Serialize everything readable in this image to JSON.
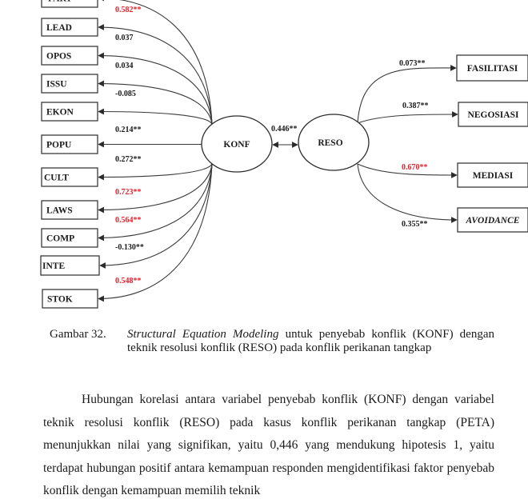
{
  "diagram": {
    "title": "Structural Equation Modeling KONF-RESO",
    "latent": {
      "konf": "KONF",
      "reso": "RESO",
      "correlation": "0.446**"
    },
    "indicators_konf": [
      {
        "label": "PART",
        "coef": "",
        "significant": false
      },
      {
        "label": "LEAD",
        "coef": "0.582**",
        "significant": true
      },
      {
        "label": "OPOS",
        "coef": "0.037",
        "significant": false
      },
      {
        "label": "ISSU",
        "coef": "0.034",
        "significant": false
      },
      {
        "label": "EKON",
        "coef": "-0.085",
        "significant": false
      },
      {
        "label": "POPU",
        "coef": "0.214**",
        "significant": false
      },
      {
        "label": "CULT",
        "coef": "0.272**",
        "significant": false
      },
      {
        "label": "LAWS",
        "coef": "0.723**",
        "significant": true
      },
      {
        "label": "COMP",
        "coef": "0.564**",
        "significant": true
      },
      {
        "label": "INTE",
        "coef": "-0.130**",
        "significant": false
      },
      {
        "label": "STOK",
        "coef": "0.548**",
        "significant": true
      }
    ],
    "indicators_reso": [
      {
        "label": "FASILITASI",
        "coef": "0.073**",
        "significant": false,
        "italic": false
      },
      {
        "label": "NEGOSIASI",
        "coef": "0.387**",
        "significant": false,
        "italic": false
      },
      {
        "label": "MEDIASI",
        "coef": "0.670**",
        "significant": true,
        "italic": false
      },
      {
        "label": "AVOIDANCE",
        "coef": "0.355**",
        "significant": false,
        "italic": true
      }
    ],
    "colors": {
      "significant": "#e8202a",
      "normal": "#1a1a1a"
    }
  },
  "caption": {
    "number": "Gambar 32.",
    "italic_part": "Structural Equation Modeling",
    "rest": " untuk penyebab konflik (KONF) dengan teknik resolusi konflik (RESO) pada konflik perikanan tangkap"
  },
  "paragraph": "Hubungan korelasi antara variabel penyebab konflik (KONF) dengan variabel teknik resolusi konflik (RESO) pada kasus konflik perikanan tangkap (PETA) menunjukkan nilai yang signifikan, yaitu 0,446 yang mendukung hipotesis 1, yaitu terdapat hubungan positif antara kemampuan responden mengidentifikasi faktor penyebab konflik dengan kemampuan memilih teknik"
}
